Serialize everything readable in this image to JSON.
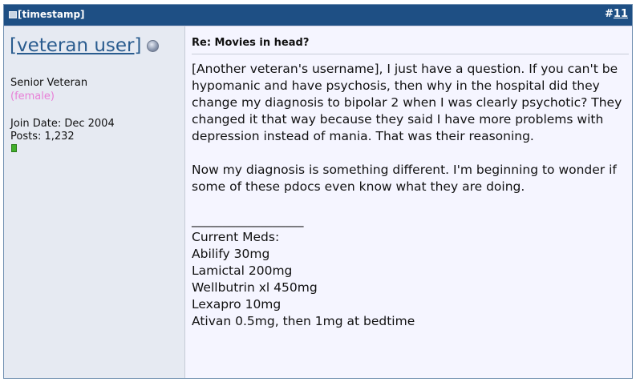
{
  "header": {
    "timestamp": "[timestamp]",
    "post_number_prefix": "#",
    "post_number": "11",
    "icon": "post-icon"
  },
  "user": {
    "username": "[veteran user]",
    "status_icon": "offline-status-icon",
    "rank": "Senior Veteran",
    "gender": "(female)",
    "join_date": "Join Date: Dec 2004",
    "posts": "Posts: 1,232",
    "reputation_color": "#41b02a"
  },
  "post": {
    "title": "Re: Movies in head?",
    "paragraph1": "[Another veteran's username], I just have a question. If you can't be hypomanic and have psychosis, then why in the hospital did they change my diagnosis to bipolar 2 when I was clearly psychotic? They changed it that way because they said I have more problems with depression instead of mania. That was their reasoning.",
    "paragraph2": "Now my diagnosis is something different. I'm beginning to wonder if some of these pdocs even know what they are doing."
  },
  "signature": {
    "separator": "__________________",
    "heading": "Current Meds:",
    "meds": [
      "Abilify 30mg",
      "Lamictal 200mg",
      "Wellbutrin xl 450mg",
      "Lexapro 10mg",
      "Ativan 0.5mg, then 1mg at bedtime"
    ]
  },
  "colors": {
    "header_bg": "#1e4f84",
    "username": "#2a5c8f",
    "gender": "#e87fd7",
    "sidebar_bg": "#e6eaf2",
    "content_bg": "#f5f5ff"
  }
}
